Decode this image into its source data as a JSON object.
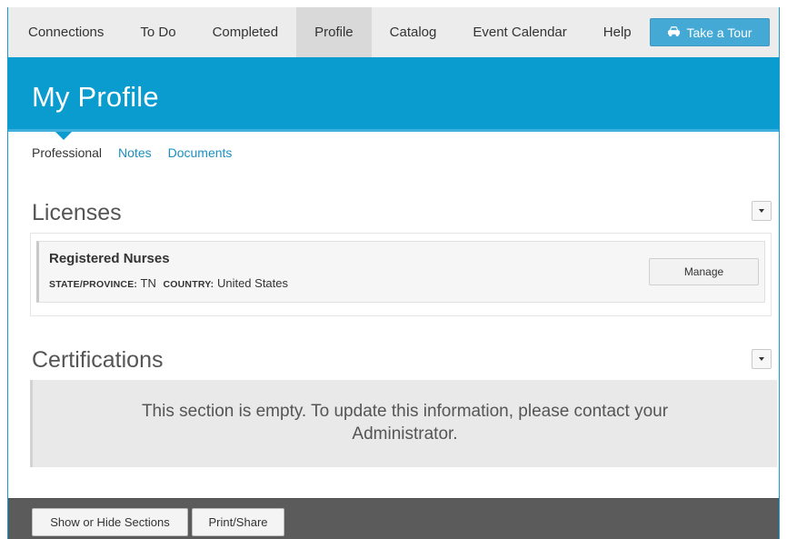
{
  "nav": {
    "items": [
      {
        "label": "Connections",
        "active": false
      },
      {
        "label": "To Do",
        "active": false
      },
      {
        "label": "Completed",
        "active": false
      },
      {
        "label": "Profile",
        "active": true
      },
      {
        "label": "Catalog",
        "active": false
      },
      {
        "label": "Event Calendar",
        "active": false
      },
      {
        "label": "Help",
        "active": false
      }
    ],
    "tour_label": "Take a Tour",
    "tour_icon": "car-icon"
  },
  "header": {
    "title": "My Profile"
  },
  "subtabs": [
    {
      "label": "Professional",
      "active": true
    },
    {
      "label": "Notes",
      "active": false
    },
    {
      "label": "Documents",
      "active": false
    }
  ],
  "licenses": {
    "title": "Licenses",
    "items": [
      {
        "name": "Registered Nurses",
        "state_label": "STATE/PROVINCE:",
        "state_value": "TN",
        "country_label": "COUNTRY:",
        "country_value": "United States",
        "action_label": "Manage"
      }
    ]
  },
  "certifications": {
    "title": "Certifications",
    "empty_message": "This section is empty. To update this information, please contact your Administrator."
  },
  "footer": {
    "show_hide_label": "Show or Hide Sections",
    "print_share_label": "Print/Share"
  },
  "colors": {
    "brand_blue": "#0a9ccf",
    "button_blue": "#45a9d6",
    "link_blue": "#1a8fc2",
    "footer_gray": "#5b5b5b"
  }
}
